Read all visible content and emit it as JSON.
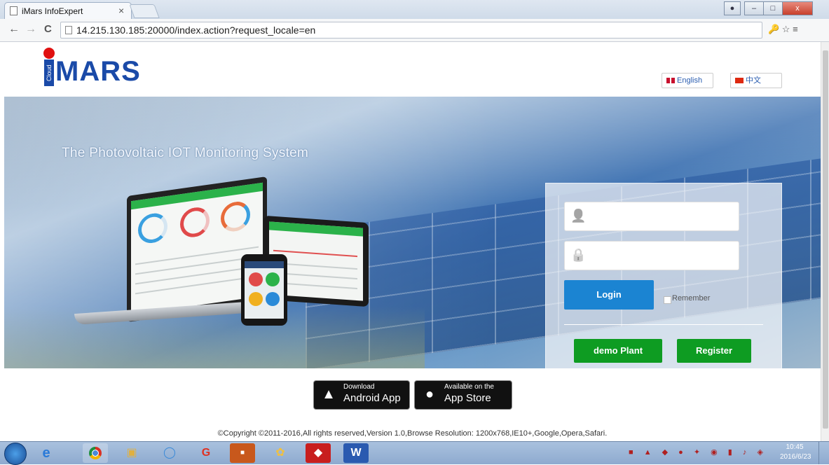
{
  "browser": {
    "tab_title": "iMars InfoExpert",
    "tab_close": "×",
    "url": "14.215.130.185:20000/index.action?request_locale=en",
    "nav_back": "←",
    "nav_forward": "→",
    "nav_reload": "C",
    "toolbar_icons": "🔑 ☆ ≡",
    "window_buttons": [
      "–",
      "□",
      "x"
    ]
  },
  "logo": {
    "brand": "MARS",
    "sub": "Cloud"
  },
  "language": {
    "english": "English",
    "chinese": "中文"
  },
  "hero": {
    "headline": "The Photovoltaic IOT Monitoring System"
  },
  "login": {
    "username_icon": "👤",
    "password_icon": "🔒",
    "username_value": "",
    "password_value": "",
    "login_label": "Login",
    "remember_label": "Remember",
    "demo_label": "demo Plant",
    "register_label": "Register"
  },
  "apps": {
    "android_small": "Download",
    "android_big": "Android App",
    "ios_small": "Available on the",
    "ios_big": "App Store"
  },
  "footer": {
    "copyright": "©Copyright ©2011-2016,All rights reserved,Version 1.0,Browse Resolution: 1200x768,IE10+,Google,Opera,Safari."
  },
  "taskbar": {
    "clock_time": "10:45",
    "clock_date": "2016/6/23",
    "tray": "■ ▲ ◆ ● ✦ ◉ ▮ ♪ ◈"
  },
  "colors": {
    "brand_blue": "#1a4aa8",
    "login_blue": "#1b84d2",
    "action_green": "#0e9c22"
  }
}
